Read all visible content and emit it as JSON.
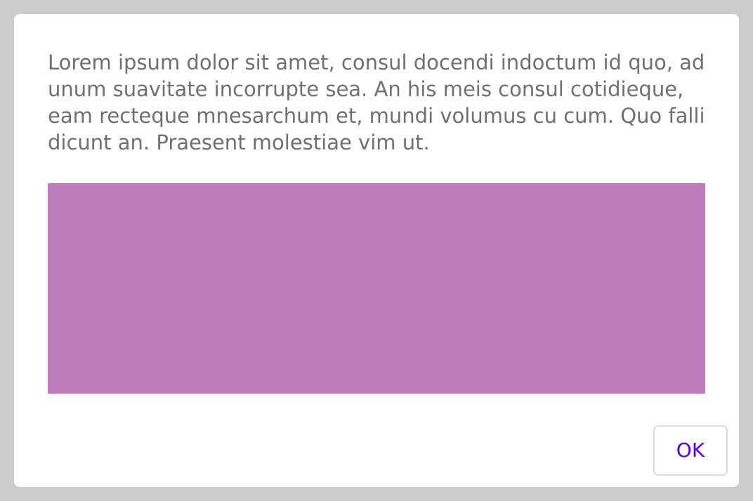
{
  "dialog": {
    "message": "Lorem ipsum dolor sit amet, consul docendi indoctum id quo, ad unum suavitate incorrupte sea. An his meis consul cotidieque, eam recteque mnesarchum et, mundi volumus cu cum. Quo falli dicunt an. Praesent molestiae vim ut.",
    "media_color": "#bf7dbe",
    "ok_label": "OK",
    "ok_color": "#5a00e0"
  }
}
